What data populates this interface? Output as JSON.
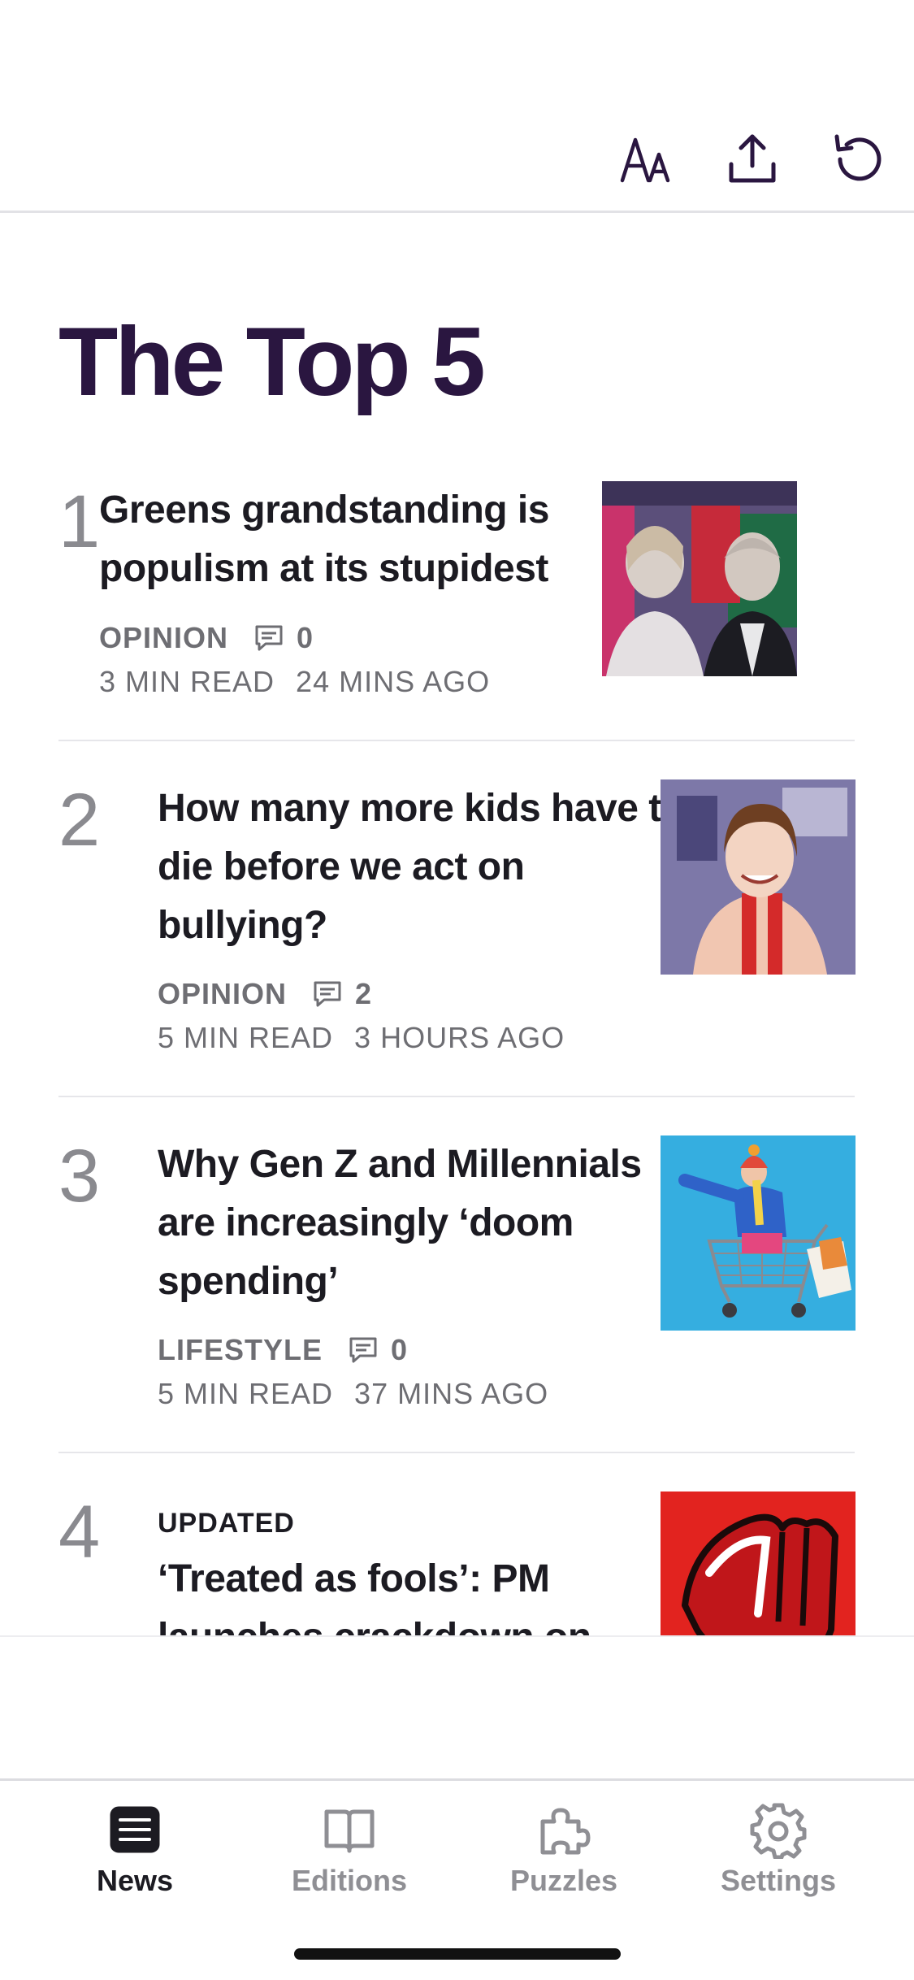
{
  "toolbar": {
    "icons": [
      "text-size-icon",
      "share-icon",
      "refresh-icon"
    ]
  },
  "page_title": "The Top 5",
  "articles": [
    {
      "rank": "1",
      "headline": "Greens grandstanding is populism at its stupidest",
      "section": "OPINION",
      "comments": "0",
      "read_time": "3 MIN READ",
      "age": "24 MINS AGO"
    },
    {
      "rank": "2",
      "headline": "How many more kids have to die before we act on bullying?",
      "section": "OPINION",
      "comments": "2",
      "read_time": "5 MIN READ",
      "age": "3 HOURS AGO"
    },
    {
      "rank": "3",
      "headline": "Why Gen Z and Millennials are increasingly ‘doom spending’",
      "section": "LIFESTYLE",
      "comments": "0",
      "read_time": "5 MIN READ",
      "age": "37 MINS AGO"
    },
    {
      "rank": "4",
      "tag": "UPDATED",
      "headline": "‘Treated as fools’: PM launches crackdown on"
    }
  ],
  "tabs": [
    {
      "label": "News",
      "active": true
    },
    {
      "label": "Editions",
      "active": false
    },
    {
      "label": "Puzzles",
      "active": false
    },
    {
      "label": "Settings",
      "active": false
    }
  ],
  "colors": {
    "title": "#2a1640",
    "accent_red": "#e2231f",
    "thumb_blue": "#35aee0",
    "muted": "#6e6e73"
  }
}
